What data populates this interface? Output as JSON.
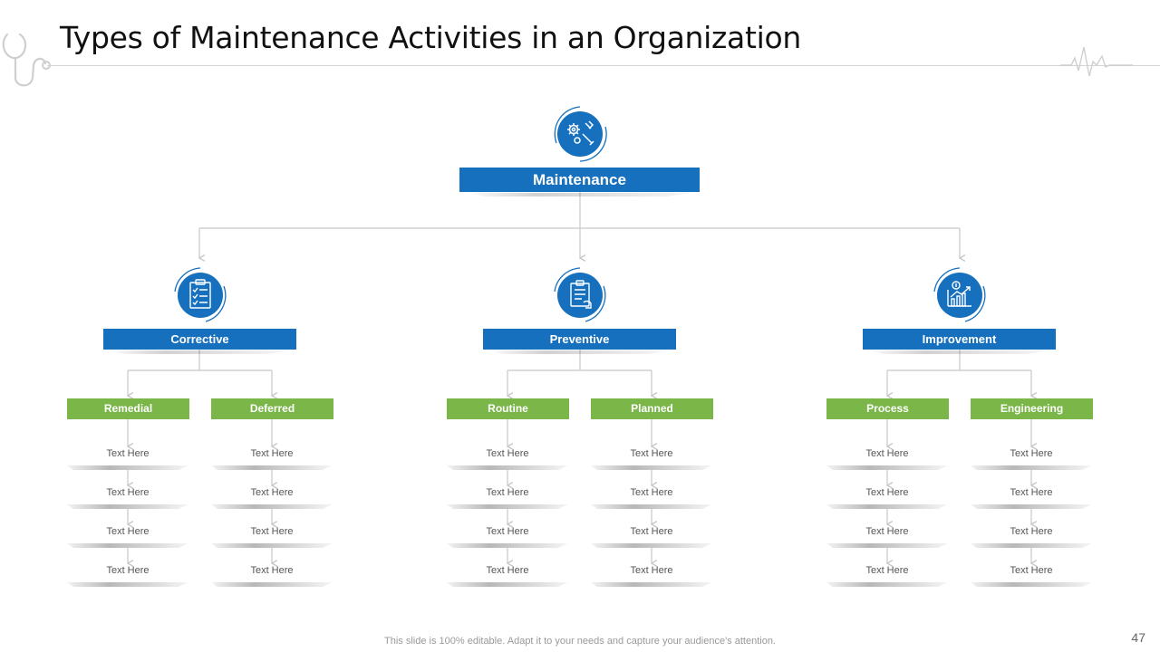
{
  "slide": {
    "title": "Types of Maintenance Activities in an Organization",
    "footer": "This slide is 100% editable. Adapt it to your needs and capture your audience's attention.",
    "page_number": "47"
  },
  "colors": {
    "blue": "#1670be",
    "green": "#7ab648",
    "line": "#c8c8c8"
  },
  "tree": {
    "root": {
      "label": "Maintenance",
      "icon": "gears-wrench-icon"
    },
    "categories": [
      {
        "label": "Corrective",
        "icon": "clipboard-checklist-icon",
        "subtypes": [
          {
            "label": "Remedial",
            "items": [
              "Text Here",
              "Text Here",
              "Text Here",
              "Text Here"
            ]
          },
          {
            "label": "Deferred",
            "items": [
              "Text Here",
              "Text Here",
              "Text Here",
              "Text Here"
            ]
          }
        ]
      },
      {
        "label": "Preventive",
        "icon": "clipboard-document-hand-icon",
        "subtypes": [
          {
            "label": "Routine",
            "items": [
              "Text Here",
              "Text Here",
              "Text Here",
              "Text Here"
            ]
          },
          {
            "label": "Planned",
            "items": [
              "Text Here",
              "Text Here",
              "Text Here",
              "Text Here"
            ]
          }
        ]
      },
      {
        "label": "Improvement",
        "icon": "growth-chart-icon",
        "subtypes": [
          {
            "label": "Process",
            "items": [
              "Text Here",
              "Text Here",
              "Text Here",
              "Text Here"
            ]
          },
          {
            "label": "Engineering",
            "items": [
              "Text Here",
              "Text Here",
              "Text Here",
              "Text Here"
            ]
          }
        ]
      }
    ]
  }
}
